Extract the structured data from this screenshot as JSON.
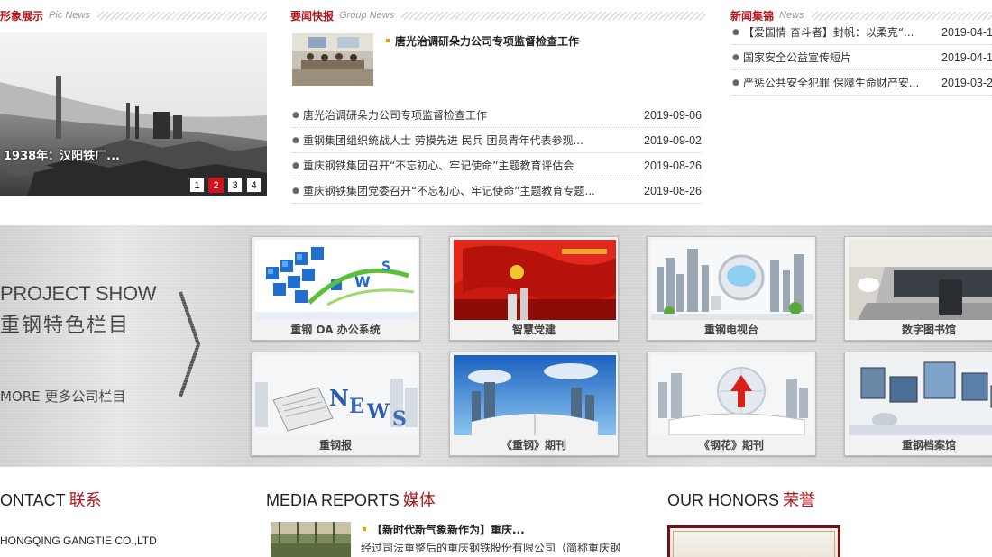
{
  "pic_news": {
    "title_cn": "形象展示",
    "title_en": "Pic News",
    "caption": "1938年：汉阳铁厂...",
    "pages": [
      "1",
      "2",
      "3",
      "4"
    ],
    "active_page": "2"
  },
  "group_news": {
    "title_cn": "要闻快报",
    "title_en": "Group News",
    "feature_title": "唐光治调研朵力公司专项监督检查工作",
    "items": [
      {
        "title": "唐光治调研朵力公司专项监督检查工作",
        "date": "2019-09-06"
      },
      {
        "title": "重钢集团组织统战人士 劳模先进 民兵 团员青年代表参观...",
        "date": "2019-09-02"
      },
      {
        "title": "重庆钢铁集团召开“不忘初心、牢记使命”主题教育评估会",
        "date": "2019-08-26"
      },
      {
        "title": "重庆钢铁集团党委召开“不忘初心、牢记使命”主题教育专题...",
        "date": "2019-08-26"
      }
    ]
  },
  "news_collection": {
    "title_cn": "新闻集锦",
    "title_en": "News",
    "items": [
      {
        "title": "【爱国情 奋斗者】封帆：以柔克“...",
        "date": "2019-04-1"
      },
      {
        "title": "国家安全公益宣传短片",
        "date": "2019-04-1"
      },
      {
        "title": "严惩公共安全犯罪 保障生命财产安...",
        "date": "2019-03-2"
      }
    ]
  },
  "project_show": {
    "title_en": "PROJECT SHOW",
    "title_cn": "重钢特色栏目",
    "more": "MORE 更多公司栏目",
    "tiles": [
      {
        "label": "重钢 OA 办公系统"
      },
      {
        "label": "智慧党建"
      },
      {
        "label": "重钢电视台"
      },
      {
        "label": "数字图书馆"
      },
      {
        "label": "重钢报"
      },
      {
        "label": "《重钢》期刊"
      },
      {
        "label": "《钢花》期刊"
      },
      {
        "label": "重钢档案馆"
      }
    ]
  },
  "contact": {
    "title_en": "ONTACT",
    "title_cn": "联系",
    "company": "HONGQING GANGTIE CO.,LTD"
  },
  "media": {
    "title_en": "MEDIA REPORTS",
    "title_cn": "媒体",
    "item_title": "【新时代新气象新作为】重庆...",
    "item_desc": "经过司法重整后的重庆钢铁股份有限公司（简称重庆钢"
  },
  "honors": {
    "title_en": "OUR HONORS",
    "title_cn": "荣誉"
  },
  "colors": {
    "accent_red": "#b3141b",
    "pager_active": "#d0121b",
    "bullet_orange": "#f39a00"
  }
}
